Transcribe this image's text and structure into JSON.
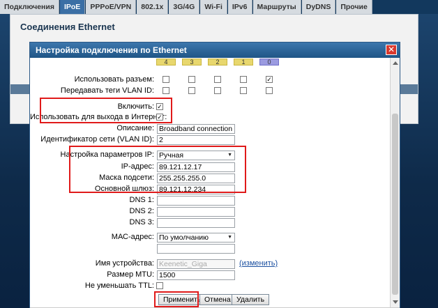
{
  "tabs": [
    "Подключения",
    "IPoE",
    "PPPoE/VPN",
    "802.1x",
    "3G/4G",
    "Wi-Fi",
    "IPv6",
    "Маршруты",
    "DyDNS",
    "Прочие"
  ],
  "active_tab": 1,
  "page": {
    "title": "Соединения Ethernet"
  },
  "dialog": {
    "title": "Настройка подключения по Ethernet",
    "ports": [
      "4",
      "3",
      "2",
      "1",
      "0"
    ],
    "use_port_label": "Использовать разъем:",
    "use_port_checked": [
      false,
      false,
      false,
      false,
      true
    ],
    "vlan_tags_label": "Передавать теги VLAN ID:",
    "vlan_tags_checked": [
      false,
      false,
      false,
      false,
      false
    ],
    "enable_label": "Включить:",
    "enable_checked": true,
    "internet_label": "Использовать для выхода в Интернет:",
    "internet_checked": true,
    "description_label": "Описание:",
    "description_value": "Broadband connection",
    "vlan_id_label": "Идентификатор сети (VLAN ID):",
    "vlan_id_value": "2",
    "ip_mode_label": "Настройка параметров IP:",
    "ip_mode_value": "Ручная",
    "ip_label": "IP-адрес:",
    "ip_value": "89.121.12.17",
    "mask_label": "Маска подсети:",
    "mask_value": "255.255.255.0",
    "gateway_label": "Основной шлюз:",
    "gateway_value": "89.121.12.234",
    "dns1_label": "DNS 1:",
    "dns2_label": "DNS 2:",
    "dns3_label": "DNS 3:",
    "mac_label": "МАС-адрес:",
    "mac_value": "По умолчанию",
    "device_name_label": "Имя устройства:",
    "device_name_value": "Keenetic_Giga",
    "change_link": "(изменить)",
    "mtu_label": "Размер MTU:",
    "mtu_value": "1500",
    "ttl_label": "Не уменьшать TTL:",
    "ttl_checked": false,
    "apply_label": "Применить",
    "cancel_label": "Отмена",
    "delete_label": "Удалить"
  },
  "colors": {
    "accent": "#1f5586",
    "highlight": "#e01a1a"
  }
}
